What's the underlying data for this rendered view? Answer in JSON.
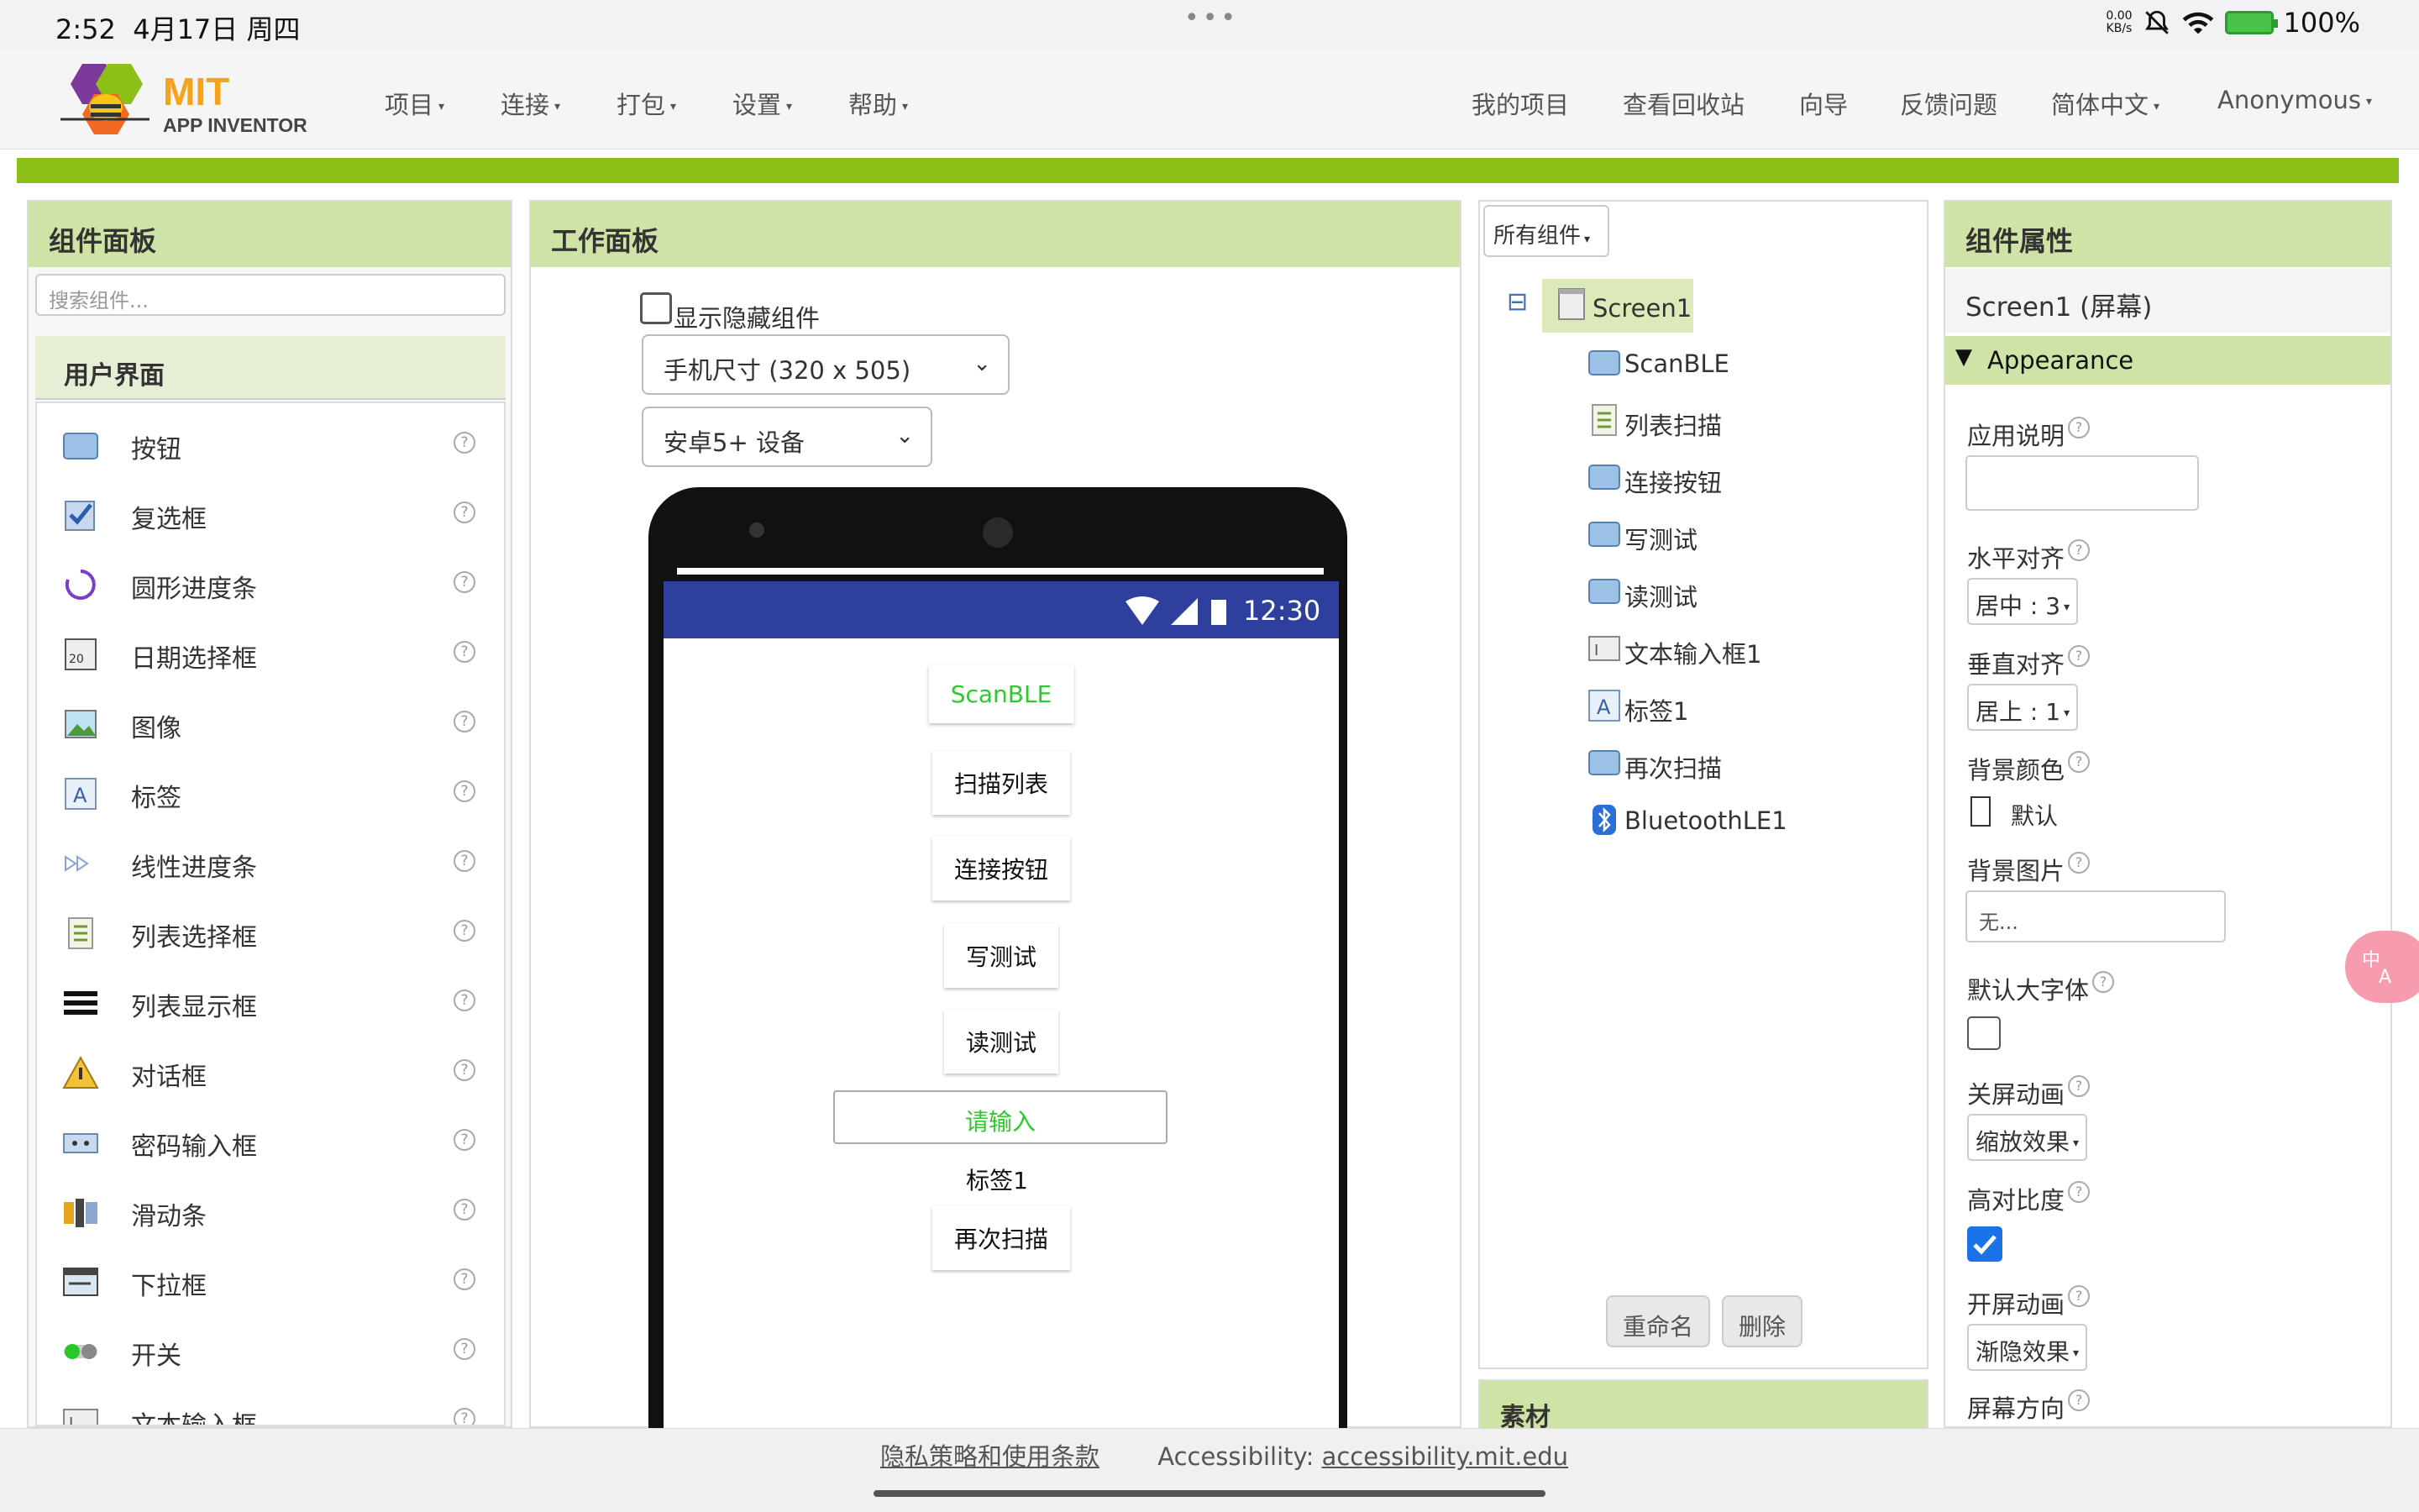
{
  "statusbar": {
    "time": "2:52",
    "date": "4月17日 周四",
    "netspeed_top": "0.00",
    "netspeed_bottom": "KB/s",
    "battery": "100%"
  },
  "brand": {
    "mit": "MIT",
    "app": "APP INVENTOR"
  },
  "menu_left": [
    "项目",
    "连接",
    "打包",
    "设置",
    "帮助"
  ],
  "menu_right": {
    "my_projects": "我的项目",
    "trash": "查看回收站",
    "guide": "向导",
    "feedback": "反馈问题",
    "language": "简体中文",
    "user": "Anonymous"
  },
  "palette": {
    "title": "组件面板",
    "search_placeholder": "搜索组件...",
    "category": "用户界面",
    "items": [
      {
        "label": "按钮",
        "icon": "button-icon"
      },
      {
        "label": "复选框",
        "icon": "checkbox-icon"
      },
      {
        "label": "圆形进度条",
        "icon": "circular-progress-icon"
      },
      {
        "label": "日期选择框",
        "icon": "date-picker-icon"
      },
      {
        "label": "图像",
        "icon": "image-icon"
      },
      {
        "label": "标签",
        "icon": "label-icon"
      },
      {
        "label": "线性进度条",
        "icon": "linear-progress-icon"
      },
      {
        "label": "列表选择框",
        "icon": "list-picker-icon"
      },
      {
        "label": "列表显示框",
        "icon": "list-view-icon"
      },
      {
        "label": "对话框",
        "icon": "notifier-icon"
      },
      {
        "label": "密码输入框",
        "icon": "password-icon"
      },
      {
        "label": "滑动条",
        "icon": "slider-icon"
      },
      {
        "label": "下拉框",
        "icon": "spinner-icon"
      },
      {
        "label": "开关",
        "icon": "switch-icon"
      },
      {
        "label": "文本输入框",
        "icon": "textbox-icon"
      }
    ],
    "help": "?"
  },
  "workspace": {
    "title": "工作面板",
    "show_hidden": "显示隐藏组件",
    "size_select": "手机尺寸 (320 x 505)",
    "device_select": "安卓5+ 设备",
    "phone_time": "12:30",
    "buttons": {
      "scan": "ScanBLE",
      "list": "扫描列表",
      "connect": "连接按钮",
      "write": "写测试",
      "read": "读测试",
      "input": "请输入",
      "label": "标签1",
      "rescan": "再次扫描"
    }
  },
  "tree": {
    "filter": "所有组件",
    "collapse": "⊟",
    "root": "Screen1",
    "children": [
      "ScanBLE",
      "列表扫描",
      "连接按钮",
      "写测试",
      "读测试",
      "文本输入框1",
      "标签1",
      "再次扫描",
      "BluetoothLE1"
    ],
    "rename": "重命名",
    "delete": "删除",
    "assets": "素材"
  },
  "props": {
    "title": "组件属性",
    "screen": "Screen1 (屏幕)",
    "section": "Appearance",
    "app_desc": "应用说明",
    "h_align": "水平对齐",
    "h_align_value": "居中 : 3",
    "v_align": "垂直对齐",
    "v_align_value": "居上 : 1",
    "bg_color": "背景颜色",
    "bg_color_value": "默认",
    "bg_image": "背景图片",
    "bg_image_value": "无...",
    "big_font": "默认大字体",
    "close_anim": "关屏动画",
    "close_anim_value": "缩放效果",
    "high_contrast": "高对比度",
    "open_anim": "开屏动画",
    "open_anim_value": "渐隐效果",
    "orientation": "屏幕方向",
    "help": "?"
  },
  "footer": {
    "privacy": "隐私策略和使用条款",
    "acc_label": "Accessibility:",
    "acc_link": "accessibility.mit.edu"
  }
}
